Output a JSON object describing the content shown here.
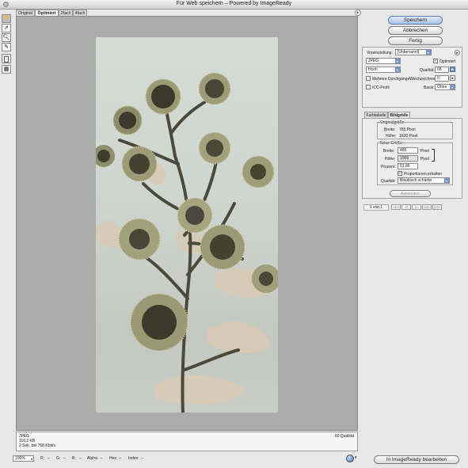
{
  "window": {
    "title": "Für Web speichern – Powered by ImageReady"
  },
  "tools": [
    "hand-icon",
    "slice-select-icon",
    "zoom-icon",
    "eyedropper-icon",
    "eyedropper-color-icon",
    "toggle-slices-icon"
  ],
  "view_tabs": [
    "Original",
    "Optimiert",
    "2fach",
    "4fach"
  ],
  "menu_arrow": "▸",
  "buttons": {
    "save": "Speichern",
    "cancel": "Abbrechen",
    "done": "Fertig",
    "edit_imageready": "In ImageReady bearbeiten"
  },
  "settings": {
    "preset_label": "Voreinstellung:",
    "preset_value": "[Unbenannt]",
    "format": "JPEG",
    "optimized_label": "Optimiert",
    "quality_level": "Hoch",
    "quality_label": "Qualität:",
    "quality_value": "68",
    "progressive_label": "Mehrere Durchgänge",
    "blur_label": "Weichzeichnen:",
    "blur_value": "0",
    "icc_label": "ICC-Profil",
    "matte_label": "Basis:",
    "matte_value": "Ohne"
  },
  "size_panel": {
    "tabs": [
      "Farbtabelle",
      "Bildgröße"
    ],
    "original_title": "Originalgröße",
    "orig_width_label": "Breite:",
    "orig_width_value": "785 Pixel",
    "orig_height_label": "Höhe:",
    "orig_height_value": "1630 Pixel",
    "new_title": "Neue Größe",
    "width_label": "Breite:",
    "width_value": "485",
    "width_unit": "Pixel",
    "height_label": "Höhe:",
    "height_value": "1006",
    "height_unit": "Pixel",
    "percent_label": "Prozent:",
    "percent_value": "61,86",
    "constrain_label": "Proportionen erhalten",
    "quality_label": "Qualität:",
    "quality_value": "Bikubisch schärfer",
    "apply": "Anwenden"
  },
  "pagination": {
    "label": "1 von 1",
    "buttons": [
      "◁◁",
      "◁",
      "▷",
      "▷▷",
      "▷▷"
    ]
  },
  "status": {
    "format": "JPEG",
    "filesize": "110,2 KB",
    "download": "2 Sek. bei 768 Kbit/s",
    "quality": "60 Qualität"
  },
  "bottom": {
    "zoom": "100%",
    "readouts": [
      {
        "label": "R:",
        "value": "--"
      },
      {
        "label": "G:",
        "value": "--"
      },
      {
        "label": "B:",
        "value": "--"
      },
      {
        "label": "Alpha:",
        "value": "--"
      },
      {
        "label": "Hex:",
        "value": "--"
      },
      {
        "label": "Index:",
        "value": "--"
      }
    ]
  }
}
